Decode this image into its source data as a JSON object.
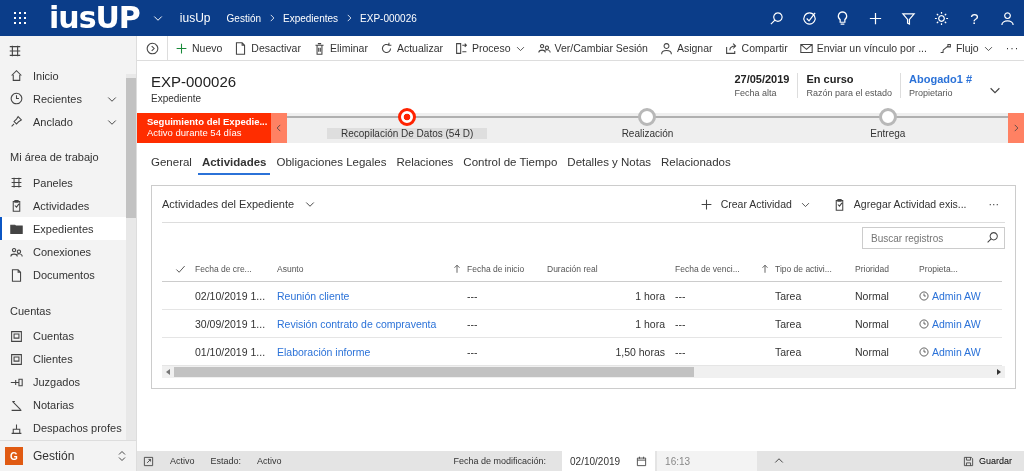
{
  "top_bar": {
    "logo": "iusUP",
    "app_name": "iusUp",
    "breadcrumb": [
      "Gestión",
      "Expedientes",
      "EXP-000026"
    ],
    "help": "?"
  },
  "sidebar": {
    "top_items": [
      {
        "label": "Inicio",
        "menu": false
      },
      {
        "label": "Recientes",
        "menu": true
      },
      {
        "label": "Anclado",
        "menu": true
      }
    ],
    "sections": [
      {
        "title": "Mi área de trabajo",
        "items": [
          {
            "label": "Paneles",
            "selected": false
          },
          {
            "label": "Actividades",
            "selected": false
          },
          {
            "label": "Expedientes",
            "selected": true
          },
          {
            "label": "Conexiones",
            "selected": false
          },
          {
            "label": "Documentos",
            "selected": false
          }
        ]
      },
      {
        "title": "Cuentas",
        "items": [
          {
            "label": "Cuentas",
            "selected": false
          },
          {
            "label": "Clientes",
            "selected": false
          },
          {
            "label": "Juzgados",
            "selected": false
          },
          {
            "label": "Notarias",
            "selected": false
          },
          {
            "label": "Despachos profes",
            "selected": false
          }
        ]
      }
    ],
    "area": {
      "badge": "G",
      "label": "Gestión"
    }
  },
  "commands": [
    {
      "label": "Nuevo",
      "menu": false
    },
    {
      "label": "Desactivar",
      "menu": false
    },
    {
      "label": "Eliminar",
      "menu": false
    },
    {
      "label": "Actualizar",
      "menu": false
    },
    {
      "label": "Proceso",
      "menu": true
    },
    {
      "label": "Ver/Cambiar Sesión",
      "menu": false
    },
    {
      "label": "Asignar",
      "menu": false
    },
    {
      "label": "Compartir",
      "menu": false
    },
    {
      "label": "Enviar un vínculo por ...",
      "menu": false
    },
    {
      "label": "Flujo",
      "menu": true
    }
  ],
  "commands_more": "···",
  "record": {
    "title": "EXP-000026",
    "entity": "Expediente",
    "fields": [
      {
        "value": "27/05/2019",
        "label": "Fecha alta",
        "kind": "text"
      },
      {
        "value": "En curso",
        "label": "Razón para el estado",
        "kind": "text"
      },
      {
        "value": "Abogado1 #",
        "label": "Propietario",
        "kind": "link"
      }
    ]
  },
  "process": {
    "flag_title": "Seguimiento del Expedie...",
    "flag_subtitle": "Activo durante 54 días",
    "stages": [
      {
        "label": "Recopilación De Datos  (54 D)",
        "selected": true
      },
      {
        "label": "Realización",
        "selected": false
      },
      {
        "label": "Entrega",
        "selected": false
      }
    ]
  },
  "tabs": [
    {
      "label": "General",
      "selected": false
    },
    {
      "label": "Actividades",
      "selected": true
    },
    {
      "label": "Obligaciones Legales",
      "selected": false
    },
    {
      "label": "Relaciones",
      "selected": false
    },
    {
      "label": "Control de Tiempo",
      "selected": false
    },
    {
      "label": "Detalles y Notas",
      "selected": false
    },
    {
      "label": "Relacionados",
      "selected": false
    }
  ],
  "subgrid": {
    "title": "Actividades del Expediente",
    "actions": [
      {
        "label": "Crear Actividad",
        "menu": true
      },
      {
        "label": "Agregar Actividad exis...",
        "menu": false
      }
    ],
    "more": "···",
    "search": {
      "placeholder": "Buscar registros"
    },
    "columns": [
      {
        "label": "Fecha de cre...",
        "sorted": false
      },
      {
        "label": "Asunto",
        "sorted": true
      },
      {
        "label": "Fecha de inicio",
        "sorted": false
      },
      {
        "label": "Duración real",
        "sorted": false
      },
      {
        "label": "Fecha de venci...",
        "sorted": true
      },
      {
        "label": "Tipo de activi...",
        "sorted": false
      },
      {
        "label": "Prioridad",
        "sorted": false
      },
      {
        "label": "Propieta...",
        "sorted": false
      }
    ],
    "rows": [
      {
        "cells": [
          "02/10/2019 1...",
          "Reunión cliente",
          "---",
          "1 hora",
          "---",
          "Tarea",
          "Normal",
          "Admin AW"
        ]
      },
      {
        "cells": [
          "30/09/2019 1...",
          "Revisión contrato de compraventa",
          "---",
          "1 hora",
          "---",
          "Tarea",
          "Normal",
          "Admin AW"
        ]
      },
      {
        "cells": [
          "01/10/2019 1...",
          "Elaboración informe",
          "---",
          "1,50 horas",
          "---",
          "Tarea",
          "Normal",
          "Admin AW"
        ]
      }
    ]
  },
  "status_bar": {
    "status": "Activo",
    "state_label": "Estado:",
    "state_value": "Activo",
    "modified_label": "Fecha de modificación:",
    "modified_date": "02/10/2019",
    "modified_time": "16:13",
    "save": "Guardar"
  }
}
